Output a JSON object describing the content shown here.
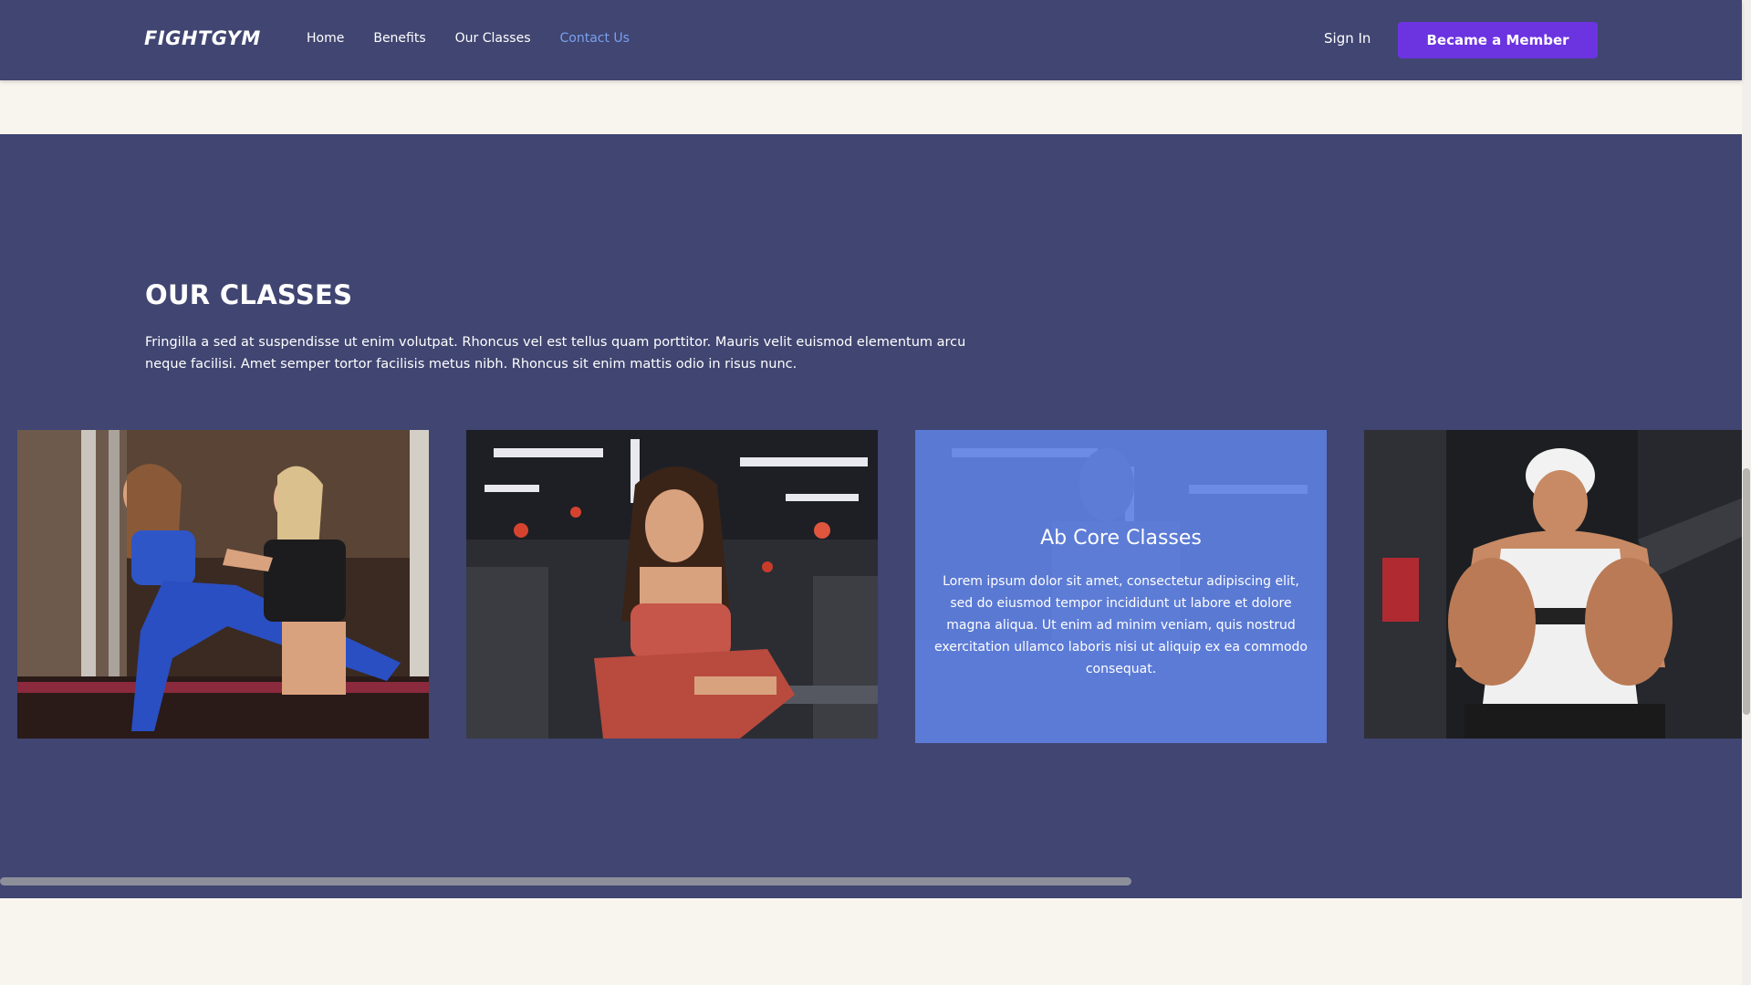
{
  "navbar": {
    "logo": "FIGHTGYM",
    "links": [
      "Home",
      "Benefits",
      "Our Classes",
      "Contact Us"
    ],
    "active_link": "Contact Us",
    "sign_in": "Sign In",
    "member_button": "Became a Member"
  },
  "classes": {
    "title": "OUR CLASSES",
    "description": "Fringilla a sed at suspendisse ut enim volutpat. Rhoncus vel est tellus quam porttitor. Mauris velit euismod elementum arcu neque facilisi. Amet semper tortor facilisis metus nibh. Rhoncus sit enim mattis odio in risus nunc.",
    "active_card": {
      "title": "Ab Core Classes",
      "text": "Lorem ipsum dolor sit amet, consectetur adipiscing elit, sed do eiusmod tempor incididunt ut labore et dolore magna aliqua. Ut enim ad minim veniam, quis nostrud exercitation ullamco laboris nisi ut aliquip ex ea commodo consequat."
    }
  },
  "colors": {
    "nav_bg": "#404571",
    "section_bg": "#404571",
    "page_bg": "#f8f4ee",
    "accent_button": "#6c33e0",
    "active_link": "#7aa0ee",
    "card_overlay": "#6082e1"
  }
}
